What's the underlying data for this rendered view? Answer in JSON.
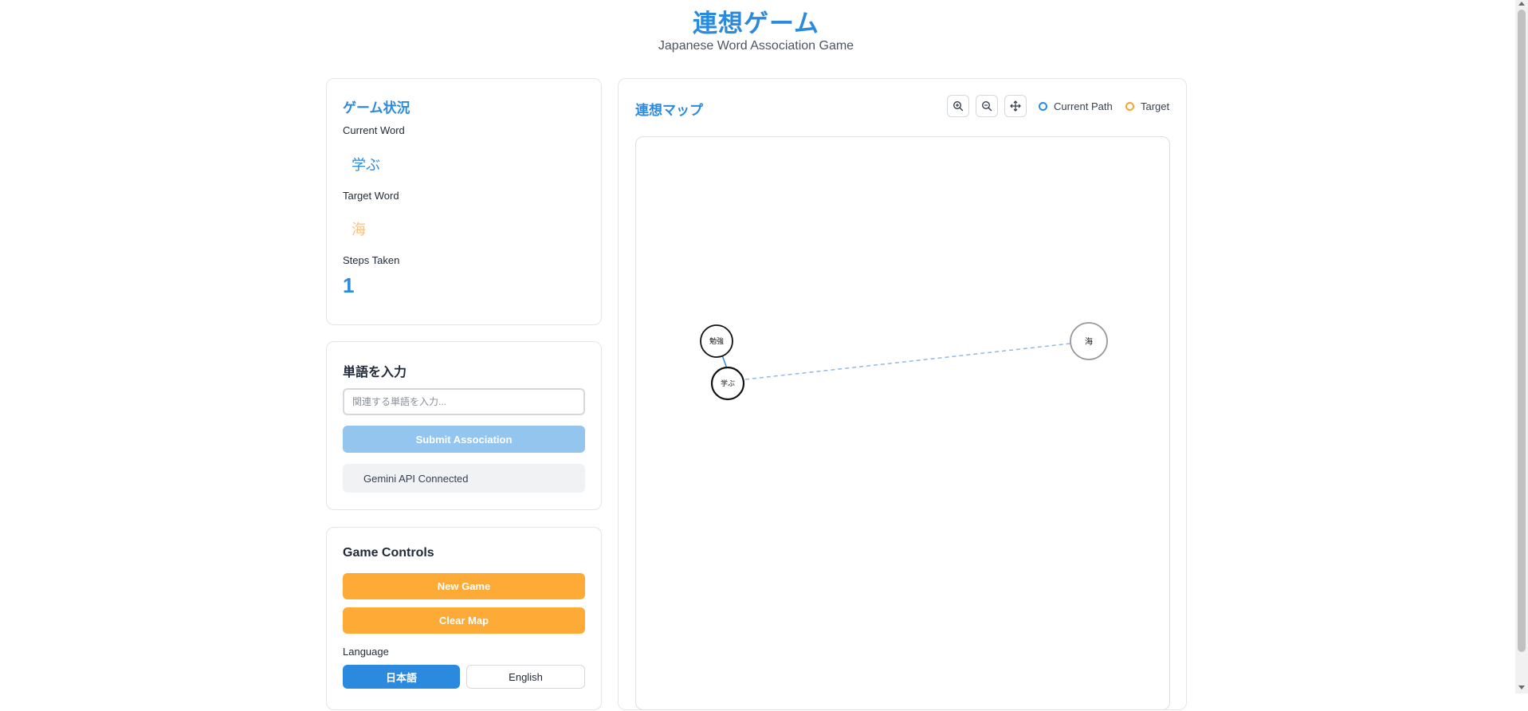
{
  "header": {
    "title": "連想ゲーム",
    "subtitle": "Japanese Word Association Game"
  },
  "status_panel": {
    "title": "ゲーム状況",
    "current_word_label": "Current Word",
    "current_word": "学ぶ",
    "target_word_label": "Target Word",
    "target_word": "海",
    "steps_label": "Steps Taken",
    "steps": "1"
  },
  "input_panel": {
    "title": "単語を入力",
    "placeholder": "関連する単語を入力...",
    "submit_label": "Submit Association",
    "api_status": "Gemini API Connected"
  },
  "controls_panel": {
    "title": "Game Controls",
    "new_game_label": "New Game",
    "clear_map_label": "Clear Map",
    "language_label": "Language",
    "languages": [
      "日本語",
      "English"
    ],
    "selected_language": "日本語"
  },
  "map_panel": {
    "title": "連想マップ",
    "tools": [
      "zoom-in-icon",
      "zoom-out-icon",
      "move-icon"
    ],
    "legend": [
      {
        "label": "Current Path",
        "color": "#2b8ade"
      },
      {
        "label": "Target",
        "color": "#f5a623"
      }
    ],
    "nodes": [
      "勉強",
      "学ぶ",
      "海"
    ]
  },
  "colors": {
    "accent": "#2b8ade",
    "orange": "#fdaa36",
    "submit_disabled": "#94c5ef",
    "target_text": "#f9c07a"
  }
}
